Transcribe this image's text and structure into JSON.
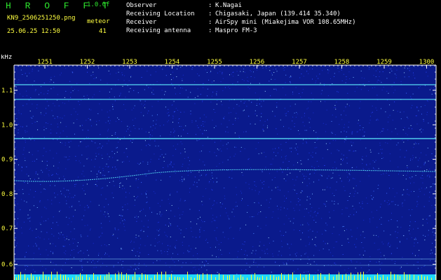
{
  "header": {
    "logo": "H R O F F T",
    "version": "1.0.0f",
    "filename": "KN9_2506251250.png",
    "datetime": "25.06.25 12:50",
    "meteor_label": "meteor",
    "meteor_count": "41",
    "fields": [
      {
        "label": "Observer",
        "value": "K.Nagai"
      },
      {
        "label": "Receiving Location",
        "value": "Chigasaki, Japan (139.414 35.340)"
      },
      {
        "label": "Receiver",
        "value": "AirSpy mini (Miakejima VOR 108.65MHz)"
      },
      {
        "label": "Receiving antenna",
        "value": "Maspro FM-3"
      }
    ]
  },
  "spectrogram": {
    "y_unit": "kHz",
    "time_ticks": [
      "1251",
      "1252",
      "1253",
      "1254",
      "1255",
      "1256",
      "1257",
      "1258",
      "1259",
      "1300"
    ],
    "freq_ticks": [
      "1.1",
      "1.0",
      "0.9",
      "0.8",
      "0.7",
      "0.6"
    ],
    "colors": {
      "background": "#0a1a8c",
      "axis": "#ffffff",
      "tick_label": "#ffff40",
      "carrier": "#5ff0ff",
      "bottom_band": "#1ed8ff",
      "bottom_spikes": "#ffff30"
    }
  }
}
